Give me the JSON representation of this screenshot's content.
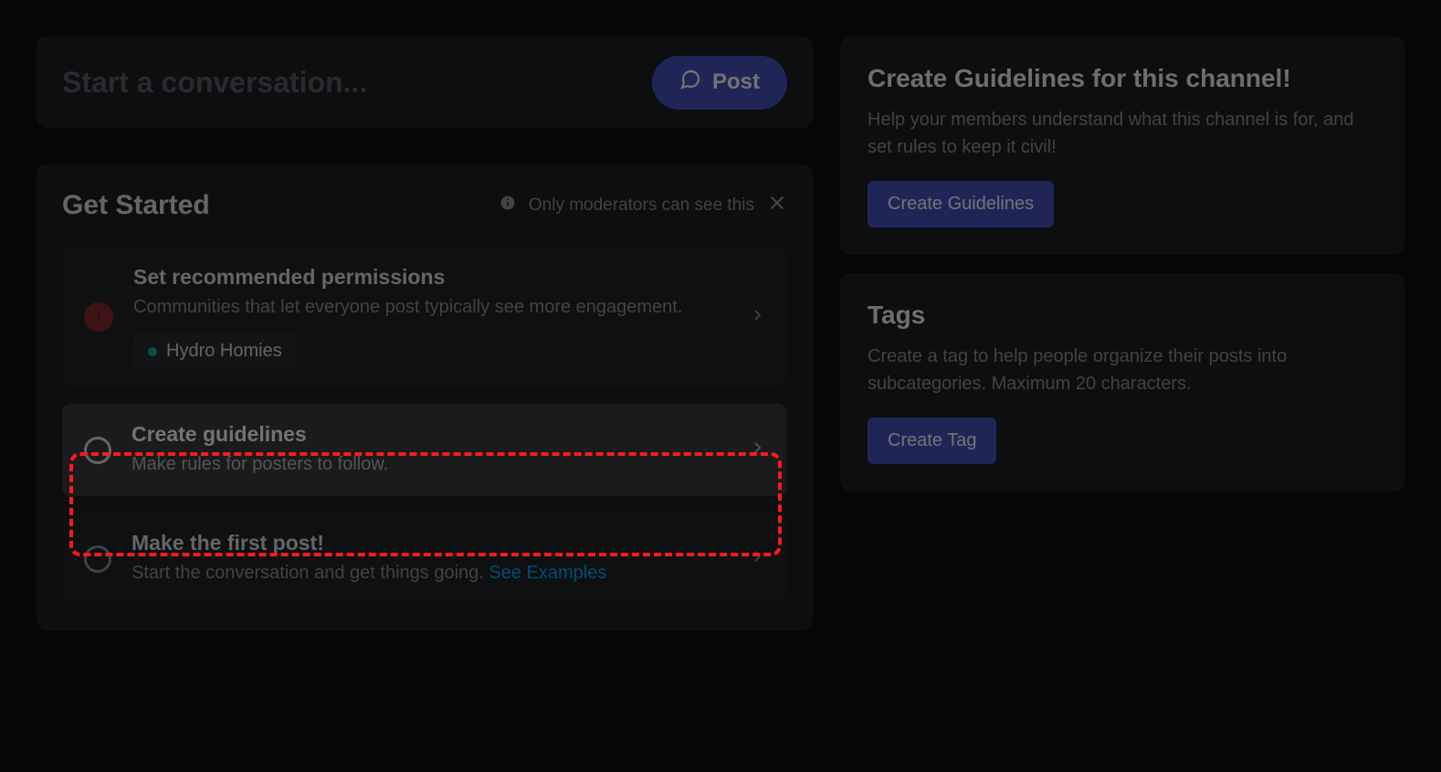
{
  "start": {
    "placeholder": "Start a conversation...",
    "post_label": "Post"
  },
  "get_started": {
    "title": "Get Started",
    "note": "Only moderators can see this",
    "items": [
      {
        "title": "Set recommended permissions",
        "desc": "Communities that let everyone post typically see more engagement.",
        "chip": "Hydro Homies"
      },
      {
        "title": "Create guidelines",
        "desc": "Make rules for posters to follow."
      },
      {
        "title": "Make the first post!",
        "desc": "Start the conversation and get things going. ",
        "link": "See Examples"
      }
    ]
  },
  "guidelines_card": {
    "title": "Create Guidelines for this channel!",
    "desc": "Help your members understand what this channel is for, and set rules to keep it civil!",
    "button": "Create Guidelines"
  },
  "tags_card": {
    "title": "Tags",
    "desc": "Create a tag to help people organize their posts into subcategories. Maximum 20 characters.",
    "button": "Create Tag"
  }
}
